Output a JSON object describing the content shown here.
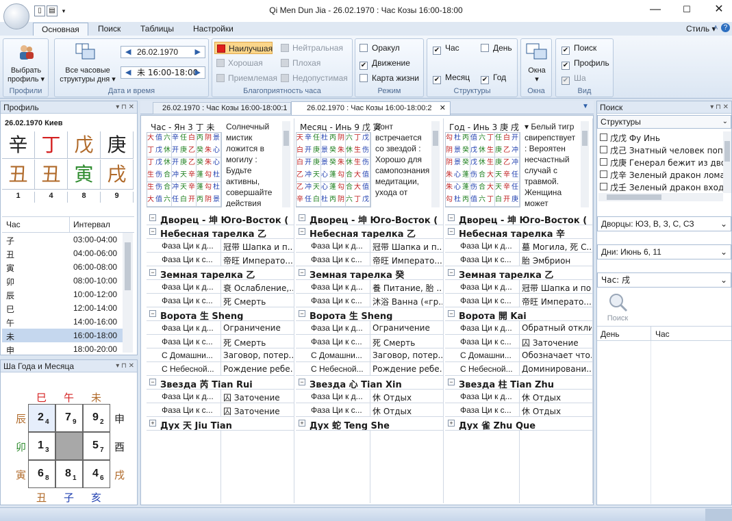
{
  "title": "Qi Men Dun Jia - 26.02.1970 : Час Козы 16:00-18:00",
  "ribbon": {
    "tabs": [
      "Основная",
      "Поиск",
      "Таблицы",
      "Настройки"
    ],
    "style_label": "Стиль",
    "profiles": {
      "button": "Выбрать профиль",
      "group": "Профили"
    },
    "datetime": {
      "button_line1": "Все часовые",
      "button_line2": "структуры дня",
      "date_value": "26.02.1970",
      "hour_value": "未 16:00-18:00",
      "group": "Дата и время"
    },
    "favor": {
      "best": "Наилучшая",
      "good": "Хорошая",
      "acceptable": "Приемлемая",
      "neutral": "Нейтральная",
      "bad": "Плохая",
      "unacceptable": "Недопустимая",
      "group": "Благоприятность часа"
    },
    "mode": {
      "oracle": "Оракул",
      "movement": "Движение",
      "lifemap": "Карта жизни",
      "group": "Режим"
    },
    "structures": {
      "hour": "Час",
      "day": "День",
      "month": "Месяц",
      "year": "Год",
      "group": "Структуры"
    },
    "windows": {
      "button": "Окна",
      "group": "Окна"
    },
    "view": {
      "search": "Поиск",
      "profile": "Профиль",
      "sha": "Ша",
      "group": "Вид"
    }
  },
  "profile_panel": {
    "title": "Профиль",
    "header": "26.02.1970 Киев",
    "stems": [
      "辛",
      "丁",
      "戊",
      "庚"
    ],
    "branches": [
      "丑",
      "丑",
      "寅",
      "戌"
    ],
    "numbers": [
      "1",
      "4",
      "8",
      "9"
    ],
    "colors": {
      "metal": "#222222",
      "fire": "#d42020",
      "earth": "#b06a2a",
      "wood": "#2e8b2e"
    },
    "hour_table": {
      "col_hour": "Час",
      "col_interval": "Интервал",
      "rows": [
        {
          "h": "子",
          "i": "03:00-04:00"
        },
        {
          "h": "丑",
          "i": "04:00-06:00"
        },
        {
          "h": "寅",
          "i": "06:00-08:00"
        },
        {
          "h": "卯",
          "i": "08:00-10:00"
        },
        {
          "h": "辰",
          "i": "10:00-12:00"
        },
        {
          "h": "巳",
          "i": "12:00-14:00"
        },
        {
          "h": "午",
          "i": "14:00-16:00"
        },
        {
          "h": "未",
          "i": "16:00-18:00"
        },
        {
          "h": "申",
          "i": "18:00-20:00"
        }
      ],
      "selected_index": 7
    }
  },
  "sha_panel": {
    "title": "Ша Года и Месяца",
    "top": [
      "巳",
      "午",
      "未"
    ],
    "bottom": [
      "丑",
      "子",
      "亥"
    ],
    "left": [
      "辰",
      "卯",
      "寅"
    ],
    "right": [
      "申",
      "酉",
      "戌"
    ],
    "grid": [
      [
        "2",
        "4"
      ],
      [
        "7",
        "9"
      ],
      [
        "9",
        "2"
      ],
      [
        "1",
        "3"
      ],
      [
        "",
        ""
      ],
      [
        "5",
        "7"
      ],
      [
        "6",
        "8"
      ],
      [
        "8",
        "1"
      ],
      [
        "4",
        "6"
      ]
    ]
  },
  "doc_tabs": [
    "26.02.1970 : Час Козы 16:00-18:00:1",
    "26.02.1970 : Час Козы 16:00-18:00:2"
  ],
  "columns": [
    {
      "header": "Час - Ян 3 丁 未",
      "desc": "Солнечный мистик ложится в могилу : Будьте активны, совершайте действия",
      "palace": "Дворец - 坤 Юго-Восток (",
      "heaven": "Небесная тарелка 乙",
      "heaven_rows": [
        [
          "Фаза Ци к д...",
          "冠带 Шапка и п..."
        ],
        [
          "Фаза Ци к с...",
          "帝旺 Императо..."
        ]
      ],
      "earth": "Земная тарелка 乙",
      "earth_rows": [
        [
          "Фаза Ци к д...",
          "衰 Ослабление,..."
        ],
        [
          "Фаза Ци к с...",
          "死 Смерть"
        ]
      ],
      "gate": "Ворота 生 Sheng",
      "gate_rows": [
        [
          "Фаза Ци к д...",
          "Ограничение"
        ],
        [
          "Фаза Ци к с...",
          "死 Смерть"
        ],
        [
          "С Домашни...",
          "Заговор, потер..."
        ],
        [
          "С Небесной...",
          "Рождение ребе..."
        ]
      ],
      "star": "Звезда 芮 Tian Rui",
      "star_rows": [
        [
          "Фаза Ци к д...",
          "囚 Заточение"
        ],
        [
          "Фаза Ци к с...",
          "囚 Заточение"
        ]
      ],
      "spirit": "Дух 天 Jiu Tian"
    },
    {
      "header": "Месяц - Инь 9 戊 寅",
      "desc": "Зонт встречается со звездой : Хорошо для самопознания, медитации, ухода от",
      "palace": "Дворец - 坤 Юго-Восток (",
      "heaven": "Небесная тарелка 乙",
      "heaven_rows": [
        [
          "Фаза Ци к д...",
          "冠带 Шапка и п..."
        ],
        [
          "Фаза Ци к с...",
          "帝旺 Императо..."
        ]
      ],
      "earth": "Земная тарелка 癸",
      "earth_rows": [
        [
          "Фаза Ци к д...",
          "養 Питание, 胎 ..."
        ],
        [
          "Фаза Ци к с...",
          "沐浴 Ванна («гр..."
        ]
      ],
      "gate": "Ворота 生 Sheng",
      "gate_rows": [
        [
          "Фаза Ци к д...",
          "Ограничение"
        ],
        [
          "Фаза Ци к с...",
          "死 Смерть"
        ],
        [
          "С Домашни...",
          "Заговор, потер..."
        ],
        [
          "С Небесной...",
          "Рождение ребе..."
        ]
      ],
      "star": "Звезда 心 Tian Xin",
      "star_rows": [
        [
          "Фаза Ци к д...",
          "休 Отдых"
        ],
        [
          "Фаза Ци к с...",
          "休 Отдых"
        ]
      ],
      "spirit": "Дух 蛇 Teng She"
    },
    {
      "header": "Год - Инь 3 庚 戌",
      "desc": "▾ Белый тигр свирепствует : Вероятен несчастный случай с травмой. Женщина может",
      "palace": "Дворец - 坤 Юго-Восток (",
      "heaven": "Небесная тарелка 辛",
      "heaven_rows": [
        [
          "Фаза Ци к д...",
          "墓 Могила, 死 С..."
        ],
        [
          "Фаза Ци к с...",
          "胎 Эмбрион"
        ]
      ],
      "earth": "Земная тарелка 乙",
      "earth_rows": [
        [
          "Фаза Ци к д...",
          "冠带 Шапка и по..."
        ],
        [
          "Фаза Ци к с...",
          "帝旺 Императо..."
        ]
      ],
      "gate": "Ворота 開 Kai",
      "gate_rows": [
        [
          "Фаза Ци к д...",
          "Обратный отклик"
        ],
        [
          "Фаза Ци к с...",
          "囚 Заточение"
        ],
        [
          "С Домашни...",
          "Обозначает что..."
        ],
        [
          "С Небесной...",
          "Доминировани..."
        ]
      ],
      "star": "Звезда 柱 Tian Zhu",
      "star_rows": [
        [
          "Фаза Ци к д...",
          "休 Отдых"
        ],
        [
          "Фаза Ци к с...",
          "休 Отдых"
        ]
      ],
      "spirit": "Дух 雀 Zhu Que"
    }
  ],
  "search_panel": {
    "title": "Поиск",
    "structures_label": "Структуры",
    "items": [
      "戊戊 Фу Инь",
      "戊己 Знатный человек попад",
      "戊庚 Генерал бежит из дворц",
      "戊辛 Зеленый дракон ломает",
      "戊壬 Зеленый дракон входит"
    ],
    "palaces": "Дворцы: ЮЗ, В, З, С, СЗ",
    "days": "Дни: Июнь 6, 11",
    "hour": "Час: 戌",
    "search_button": "Поиск",
    "col_day": "День",
    "col_hour": "Час"
  }
}
